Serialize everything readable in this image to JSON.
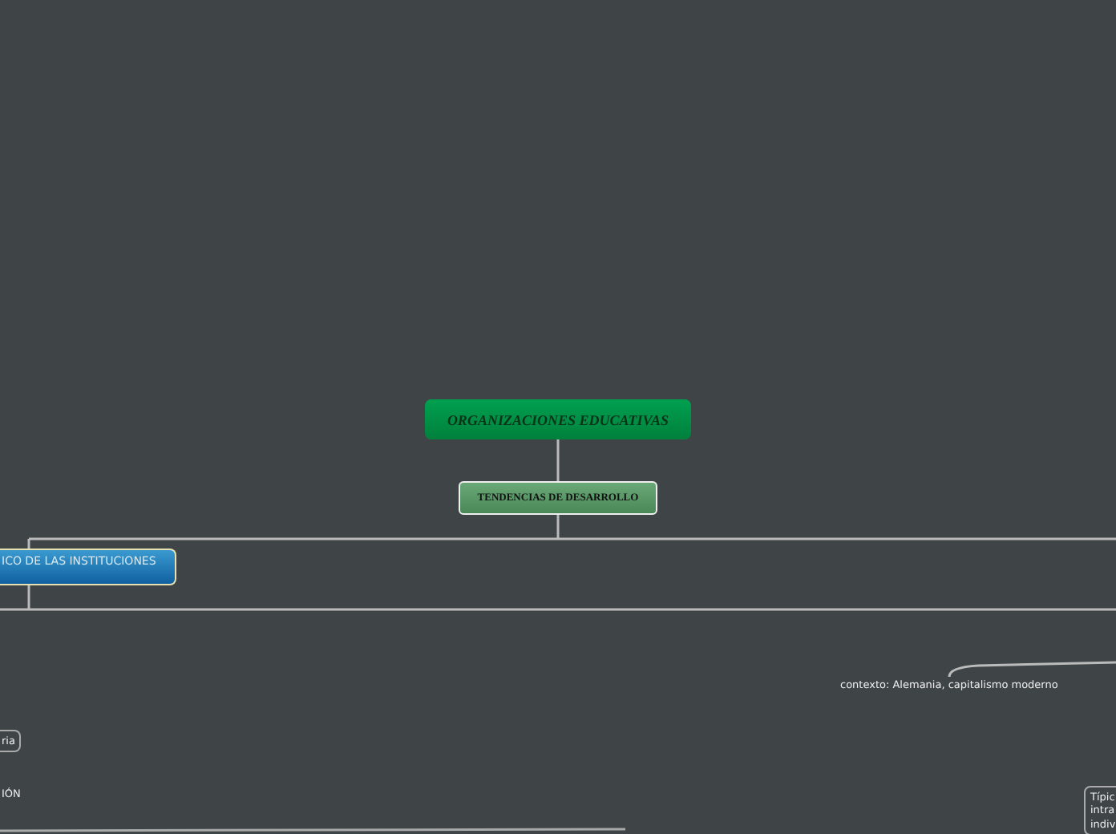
{
  "map": {
    "nodes": [
      {
        "kind": "root",
        "text": "ORGANIZACIONES EDUCATIVAS"
      },
      {
        "kind": "main",
        "text": "TENDENCIAS DE DESARROLLO"
      },
      {
        "kind": "blue",
        "text": "ICO DE LAS INSTITUCIONES"
      },
      {
        "kind": "outline",
        "text": "ria"
      },
      {
        "kind": "plain",
        "text": "IÓN"
      },
      {
        "kind": "plain",
        "text": "contexto: Alemania, capitalismo moderno"
      },
      {
        "kind": "outline",
        "text": "Típic\nintra\nindiv"
      }
    ]
  }
}
